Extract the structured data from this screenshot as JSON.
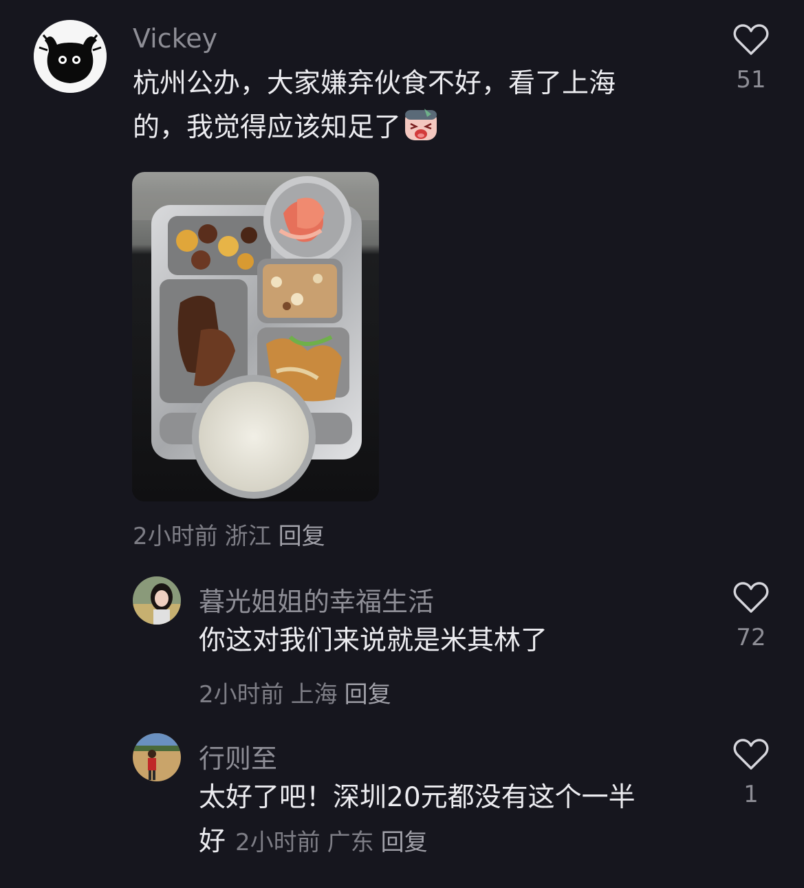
{
  "comments": [
    {
      "username": "Vickey",
      "text_line1": "杭州公办，大家嫌弃伙食不好，看了上海",
      "text_line2": "的，我觉得应该知足了",
      "emoji": "crying-face-emoji",
      "time": "2小时前",
      "location": "浙江",
      "reply_label": "回复",
      "likes": "51",
      "photo": "food-tray-photo"
    },
    {
      "username": "暮光姐姐的幸福生活",
      "text_line1": "你这对我们来说就是米其林了",
      "time": "2小时前",
      "location": "上海",
      "reply_label": "回复",
      "likes": "72"
    },
    {
      "username": "行则至",
      "text_line1": "太好了吧！深圳20元都没有这个一半",
      "text_line2": "好",
      "time": "2小时前",
      "location": "广东",
      "reply_label": "回复",
      "likes": "1"
    }
  ],
  "icons": {
    "like": "heart-outline-icon"
  },
  "colors": {
    "background": "#16161e",
    "primary_text": "#ececf0",
    "secondary_text": "#8e8e96"
  }
}
